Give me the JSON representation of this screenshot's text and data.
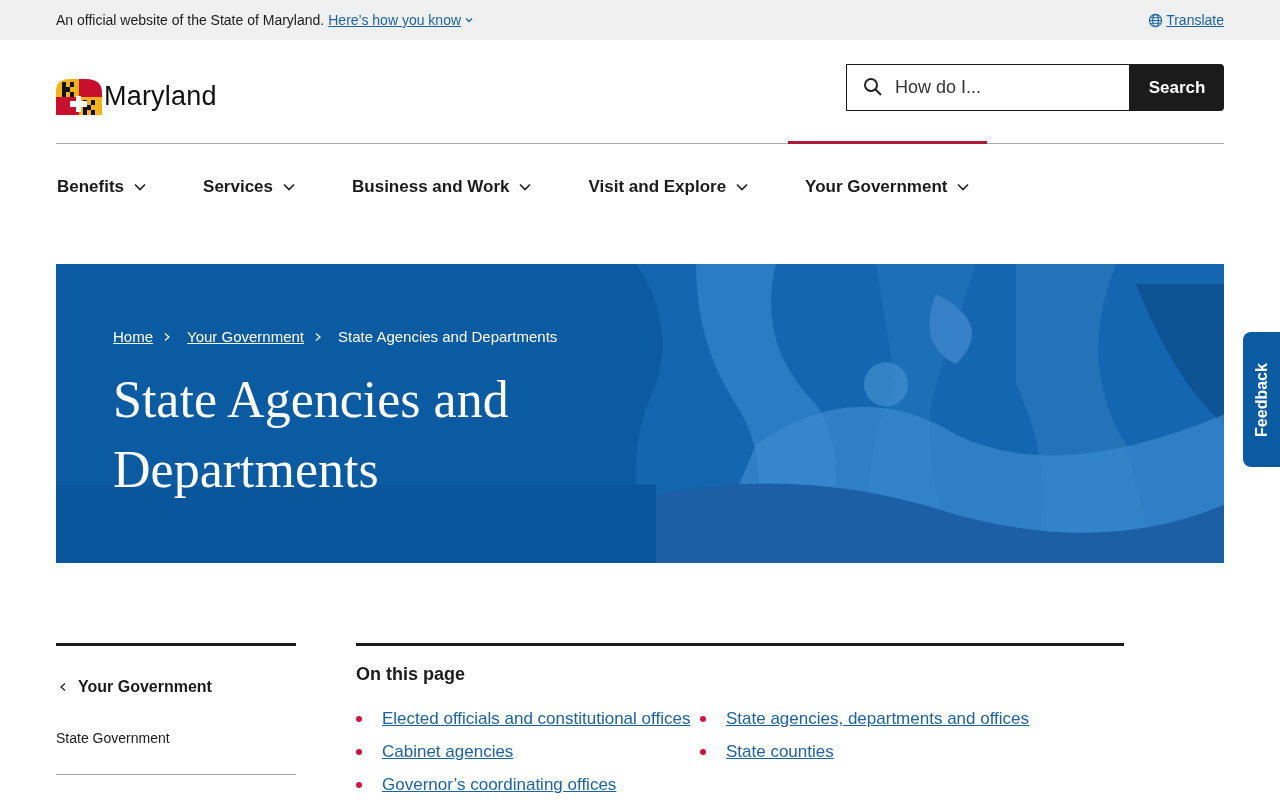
{
  "banner": {
    "text": "An official website of the State of Maryland.",
    "link": "Here’s how you know",
    "translate": "Translate"
  },
  "logo": {
    "wordmark": "Maryland"
  },
  "search": {
    "placeholder": "How do I...",
    "button": "Search"
  },
  "nav": [
    {
      "label": "Benefits",
      "selected": false
    },
    {
      "label": "Services",
      "selected": false
    },
    {
      "label": "Business and Work",
      "selected": false
    },
    {
      "label": "Visit and Explore",
      "selected": false
    },
    {
      "label": "Your Government",
      "selected": true
    }
  ],
  "hero": {
    "breadcrumbs": [
      "Home",
      "Your Government"
    ],
    "current": "State Agencies and Departments",
    "title": "State Agencies and Departments"
  },
  "feedback": "Feedback",
  "sidebar": {
    "back": "Your Government",
    "items": [
      "State Government"
    ]
  },
  "on_this_page": {
    "heading": "On this page",
    "links": [
      "Elected officials and constitutional offices",
      "State agencies, departments and offices",
      "Cabinet agencies",
      "State counties",
      "Governor’s coordinating offices"
    ]
  }
}
